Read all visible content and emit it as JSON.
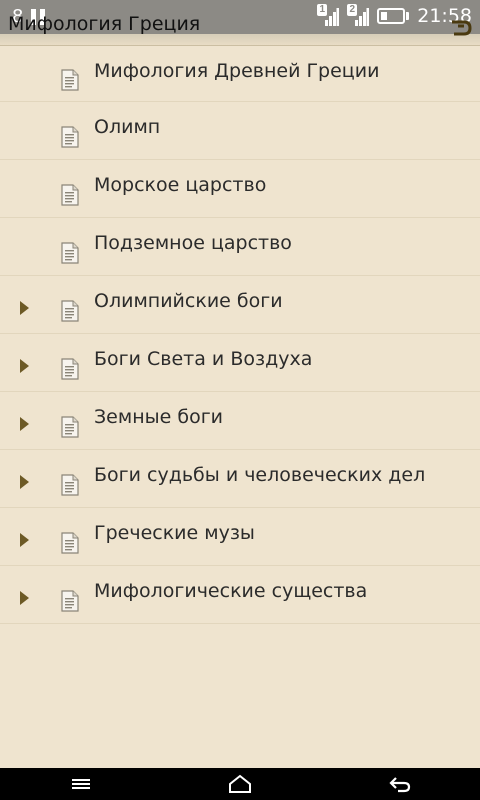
{
  "status": {
    "notif_count": "8",
    "sim1_label": "1",
    "sim2_label": "2",
    "time": "21:58"
  },
  "app": {
    "title": "Мифология Греция"
  },
  "items": [
    {
      "label": "Мифология Древней Греции",
      "expandable": false
    },
    {
      "label": "Олимп",
      "expandable": false
    },
    {
      "label": "Морское царство",
      "expandable": false
    },
    {
      "label": "Подземное царство",
      "expandable": false
    },
    {
      "label": "Олимпийские боги",
      "expandable": true
    },
    {
      "label": "Боги Света и Воздуха",
      "expandable": true
    },
    {
      "label": "Земные боги",
      "expandable": true
    },
    {
      "label": "Боги судьбы и человеческих дел",
      "expandable": true
    },
    {
      "label": "Греческие музы",
      "expandable": true
    },
    {
      "label": "Мифологические существа",
      "expandable": true
    }
  ],
  "icons": {
    "item": "document-icon",
    "expand": "expand-arrow-icon",
    "nav": [
      "menu-icon",
      "home-icon",
      "back-icon"
    ]
  },
  "colors": {
    "background": "#efe4cf",
    "statusbar": "#8c8a85",
    "expand_arrow": "#6d5a26",
    "navbar": "#000000"
  }
}
